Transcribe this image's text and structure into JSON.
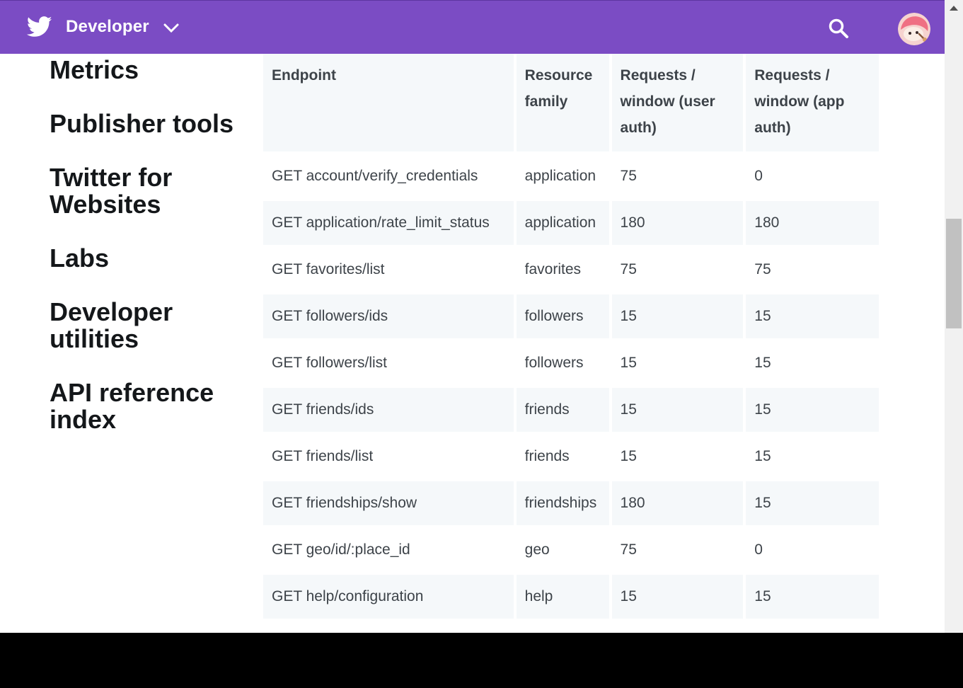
{
  "header": {
    "brand_label": "Developer",
    "accent_color": "#7b4cc4",
    "icons": [
      "twitter-bird-icon",
      "chevron-down-icon",
      "search-icon",
      "avatar"
    ]
  },
  "sidebar": {
    "items": [
      {
        "label": "Metrics"
      },
      {
        "label": "Publisher tools"
      },
      {
        "label": "Twitter for Websites"
      },
      {
        "label": "Labs"
      },
      {
        "label": "Developer utilities"
      },
      {
        "label": "API reference index"
      }
    ]
  },
  "table": {
    "headers": [
      "Endpoint",
      "Resource family",
      "Requests / window (user auth)",
      "Requests / window (app auth)"
    ],
    "rows": [
      {
        "endpoint": "GET account/verify_credentials",
        "family": "application",
        "user": "75",
        "app": "0"
      },
      {
        "endpoint": "GET application/rate_limit_status",
        "family": "application",
        "user": "180",
        "app": "180"
      },
      {
        "endpoint": "GET favorites/list",
        "family": "favorites",
        "user": "75",
        "app": "75"
      },
      {
        "endpoint": "GET followers/ids",
        "family": "followers",
        "user": "15",
        "app": "15"
      },
      {
        "endpoint": "GET followers/list",
        "family": "followers",
        "user": "15",
        "app": "15"
      },
      {
        "endpoint": "GET friends/ids",
        "family": "friends",
        "user": "15",
        "app": "15"
      },
      {
        "endpoint": "GET friends/list",
        "family": "friends",
        "user": "15",
        "app": "15"
      },
      {
        "endpoint": "GET friendships/show",
        "family": "friendships",
        "user": "180",
        "app": "15"
      },
      {
        "endpoint": "GET geo/id/:place_id",
        "family": "geo",
        "user": "75",
        "app": "0"
      },
      {
        "endpoint": "GET help/configuration",
        "family": "help",
        "user": "15",
        "app": "15"
      }
    ]
  }
}
